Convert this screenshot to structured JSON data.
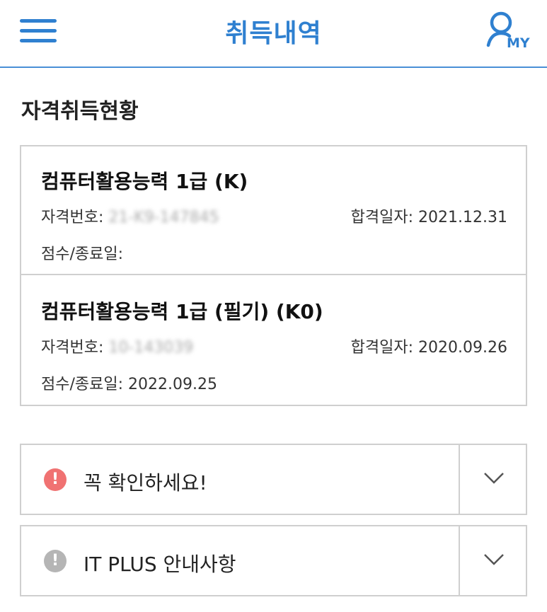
{
  "header": {
    "title": "취득내역",
    "my_label": "MY"
  },
  "section": {
    "title": "자격취득현황"
  },
  "certificates": [
    {
      "name": "컴퓨터활용능력 1급 (K)",
      "number_label": "자격번호:",
      "number_value": "21-K9-147845",
      "pass_date": "합격일자: 2021.12.31",
      "score_label": "점수/종료일:"
    },
    {
      "name": "컴퓨터활용능력 1급 (필기) (K0)",
      "number_label": "자격번호:",
      "number_value": "10-143039",
      "pass_date": "합격일자: 2020.09.26",
      "score_label": "점수/종료일: 2022.09.25"
    }
  ],
  "notices": [
    {
      "label": "꼭 확인하세요!",
      "icon_color": "#f07272",
      "icon": "exclamation-icon"
    },
    {
      "label": "IT PLUS 안내사항",
      "icon_color": "#b5b5b5",
      "icon": "exclamation-icon"
    }
  ],
  "colors": {
    "brand": "#2f80d0",
    "border": "#cfcfcf",
    "alert": "#f07272",
    "muted": "#b5b5b5"
  }
}
